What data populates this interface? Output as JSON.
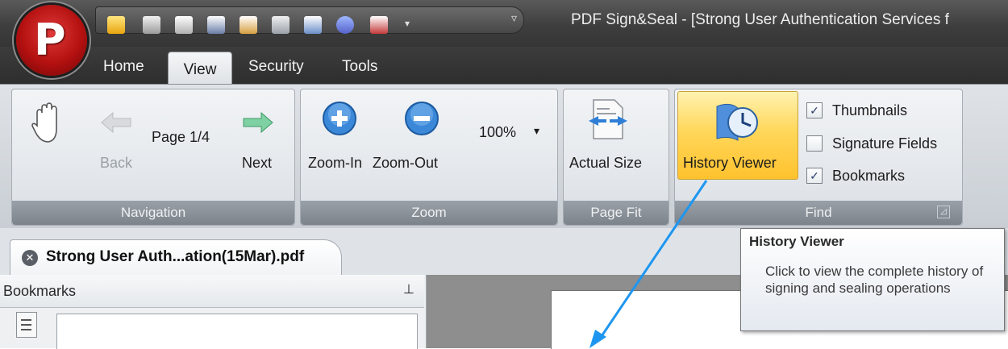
{
  "window": {
    "title": "PDF Sign&Seal - [Strong User Authentication Services f",
    "quick_access_icons": [
      "folder-icon",
      "save-icon",
      "print-icon",
      "sign-icon",
      "seal-icon",
      "verify-icon",
      "certify-icon",
      "stamp-icon",
      "export-icon",
      "dropdown-icon",
      "customize-icon"
    ]
  },
  "tabs": [
    {
      "label": "Home",
      "active": false
    },
    {
      "label": "View",
      "active": true
    },
    {
      "label": "Security",
      "active": false
    },
    {
      "label": "Tools",
      "active": false
    }
  ],
  "ribbon": {
    "navigation": {
      "group_label": "Navigation",
      "page_label": "Page 1/4",
      "back_label": "Back",
      "next_label": "Next",
      "back_enabled": false
    },
    "zoom": {
      "group_label": "Zoom",
      "zoom_in_label": "Zoom-In",
      "zoom_out_label": "Zoom-Out",
      "zoom_value": "100%"
    },
    "page_fit": {
      "group_label": "Page Fit",
      "actual_size_label": "Actual Size"
    },
    "find": {
      "group_label": "Find",
      "history_viewer_label": "History Viewer",
      "checkboxes": [
        {
          "label": "Thumbnails",
          "checked": true
        },
        {
          "label": "Signature Fields",
          "checked": false
        },
        {
          "label": "Bookmarks",
          "checked": true
        }
      ]
    }
  },
  "document": {
    "tab_label": "Strong User Auth...ation(15Mar).pdf",
    "bookmarks_title": "Bookmarks"
  },
  "tooltip": {
    "title": "History Viewer",
    "body": "Click to view the complete history of signing and sealing operations"
  },
  "colors": {
    "accent_arrow": "#1e96f0",
    "history_button": "#ffd75a",
    "logo_red": "#c41515"
  }
}
